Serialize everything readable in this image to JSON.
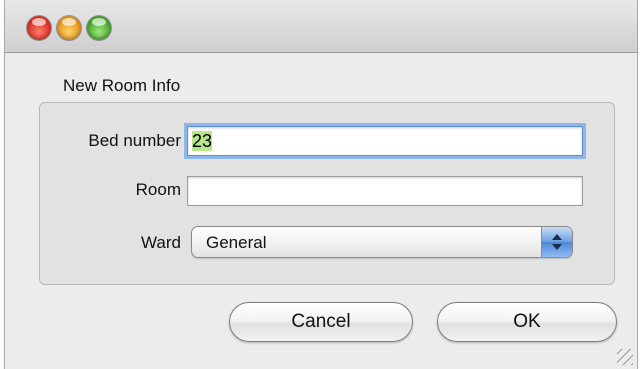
{
  "window": {
    "title_controls": [
      "close",
      "minimize",
      "zoom"
    ]
  },
  "form": {
    "group_title": "New Room Info",
    "bed_number": {
      "label": "Bed number",
      "value": "23"
    },
    "room": {
      "label": "Room",
      "value": ""
    },
    "ward": {
      "label": "Ward",
      "selected": "General"
    }
  },
  "buttons": {
    "cancel": "Cancel",
    "ok": "OK"
  },
  "colors": {
    "focus_ring": "#8fb6ea",
    "selection": "#b8e68a",
    "popup_arrow_accent": "#4c86d6"
  }
}
